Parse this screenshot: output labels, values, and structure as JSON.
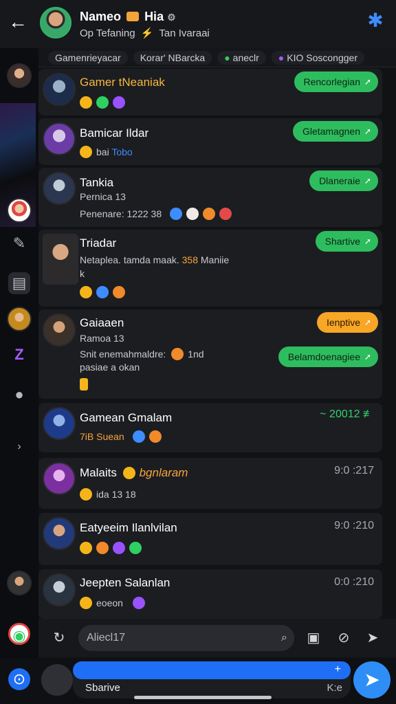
{
  "header": {
    "back_icon": "arrow-left-icon",
    "title": "Nameo",
    "title_suffix": "Hia",
    "subtitle_left": "Op Tefaning",
    "subtitle_right": "Tan Ivaraai",
    "settings_icon": "gear-icon",
    "accent": "#3d8dff"
  },
  "filters": [
    "Gamenrieyacar",
    "Korar' NBarcka",
    "aneclr",
    "KIO Soscongger"
  ],
  "chats": [
    {
      "name": "Gamer tNeaniak",
      "line1": "",
      "pill": "Rencorlegian",
      "pill_color": "#2ebd5e"
    },
    {
      "name": "Bamicar Ildar",
      "line1": "bai",
      "line1_blue": "Tobo",
      "pill": "Gletamagnen",
      "pill_color": "#2ebd5e"
    },
    {
      "name": "Tankia",
      "line1": "Pernica 13",
      "line2": "Penenare: 1222   38",
      "pill": "Dlaneraie",
      "pill_color": "#2ebd5e"
    },
    {
      "name": "Triadar",
      "line1": "Netaplea. tamda maak.",
      "line1_orange": "358",
      "line1_tail": "Maniie",
      "line2": "k",
      "pill": "Shartive",
      "pill_color": "#2ebd5e"
    },
    {
      "name": "Gaiaaen",
      "line1": "Ramoa 13",
      "line2": "Snit enemahmaldre:",
      "line2_tail": "1nd",
      "line3": "pasiae a okan",
      "pill": "Ienptive",
      "pill_color": "#f7a626",
      "pill2": "Belamdoenagiee",
      "pill2_color": "#2ebd5e"
    },
    {
      "name": "Gamean Gmalam",
      "line1": "7iB Suean",
      "time": "~ 20012 ≢",
      "time_color": "#32d36c"
    },
    {
      "name": "Malaits",
      "name_tail": "bgnlaram",
      "line1": "ida  13 18",
      "time": "9:0 :217"
    },
    {
      "name": "Eatyeeim Ilanlvilan",
      "line1": "",
      "time": "9:0 :210"
    },
    {
      "name": "Jeepten Salanlan",
      "line1": "eoeon",
      "time": "0:0 :210"
    }
  ],
  "composer": {
    "placeholder": "Aliecl17",
    "left_icon": "refresh-icon",
    "search_icon": "search-icon",
    "icons": [
      "sticker-icon",
      "compass-icon",
      "send-outline-icon"
    ]
  },
  "bottom_bar": {
    "label": "Sbarive",
    "right_text": "K:e",
    "send_icon": "send-icon"
  },
  "rail_icons": [
    "wand-icon",
    "subtitle-icon",
    "purple-z-icon",
    "chat-bubble-icon",
    "chevron-right-icon",
    "radio-icon",
    "app-icon"
  ]
}
